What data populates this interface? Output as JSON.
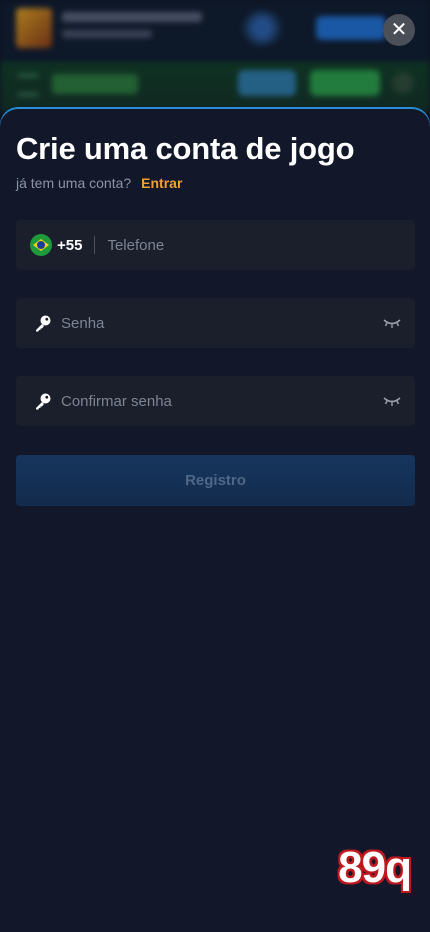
{
  "overlay": {
    "close_label": "✕"
  },
  "form": {
    "title": "Crie uma conta de jogo",
    "subtitle": "já tem uma conta?",
    "login_link": "Entrar",
    "country_code": "+55",
    "phone_placeholder": "Telefone",
    "password_placeholder": "Senha",
    "confirm_placeholder": "Confirmar senha",
    "register_label": "Registro"
  },
  "icons": {
    "flag": "brazil-flag-icon",
    "key": "key-icon",
    "eye": "eye-closed-icon",
    "close": "close-icon"
  },
  "colors": {
    "accent": "#f0a032",
    "sheet_bg": "#121829",
    "field_bg": "#1b1f2b",
    "button_bg": "#16355e"
  },
  "watermark": {
    "text": "89q"
  }
}
